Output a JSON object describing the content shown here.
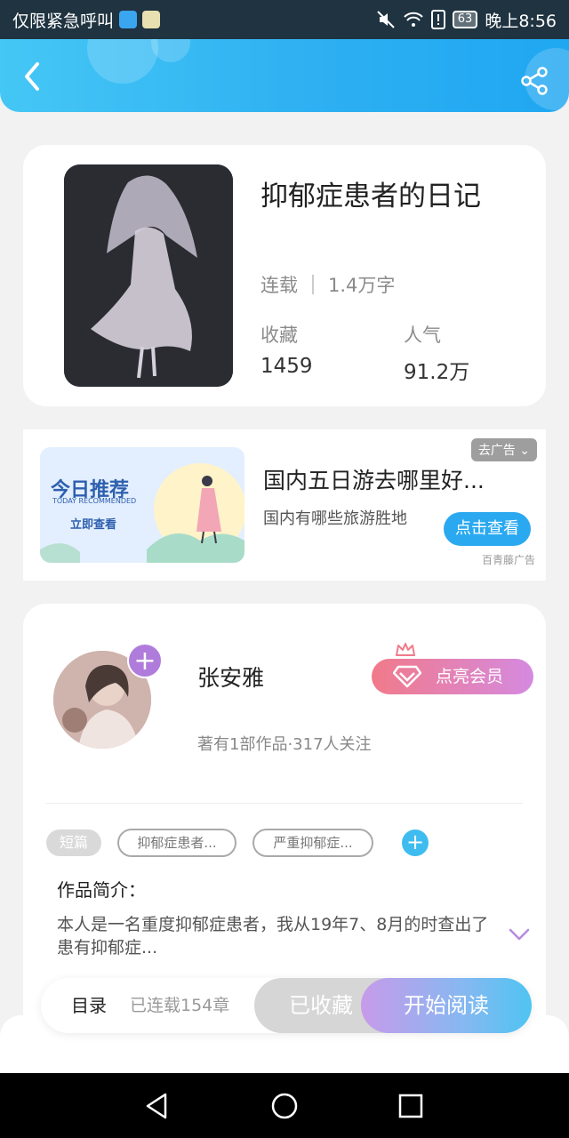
{
  "status_bar": {
    "carrier_text": "仅限紧急呼叫",
    "battery": "63",
    "time": "晚上8:56"
  },
  "header": {
    "back_icon": "chevron-left-icon",
    "share_icon": "share-icon"
  },
  "book": {
    "title": "抑郁症患者的日记",
    "status": "连载",
    "word_count": "1.4万字",
    "stats": [
      {
        "label": "收藏",
        "value": "1459"
      },
      {
        "label": "人气",
        "value": "91.2万"
      }
    ]
  },
  "ad": {
    "tag": "去广告",
    "image_title": "今日推荐",
    "image_subtitle": "TODAY RECOMMENDED",
    "image_cta": "立即查看",
    "title": "国内五日游去哪里好...",
    "description": "国内有哪些旅游胜地",
    "button": "点击查看",
    "source": "百青藤广告"
  },
  "author": {
    "name": "张安雅",
    "meta": "著有1部作品·317人关注",
    "follow_symbol": "+",
    "vip_button": "点亮会员"
  },
  "tags": {
    "type_tag": "短篇",
    "items": [
      "抑郁症患者...",
      "严重抑郁症..."
    ],
    "add_symbol": "+"
  },
  "intro": {
    "title": "作品简介：",
    "text": "本人是一名重度抑郁症患者，我从19年7、8月的时查出了患有抑郁症..."
  },
  "bottom_bar": {
    "toc": "目录",
    "chapters": "已连载154章",
    "collected": "已收藏",
    "read": "开始阅读"
  },
  "colors": {
    "accent": "#2ba9f0",
    "vip_start": "#f17a8a",
    "vip_end": "#d58ae0",
    "follow": "#b07cdc"
  }
}
